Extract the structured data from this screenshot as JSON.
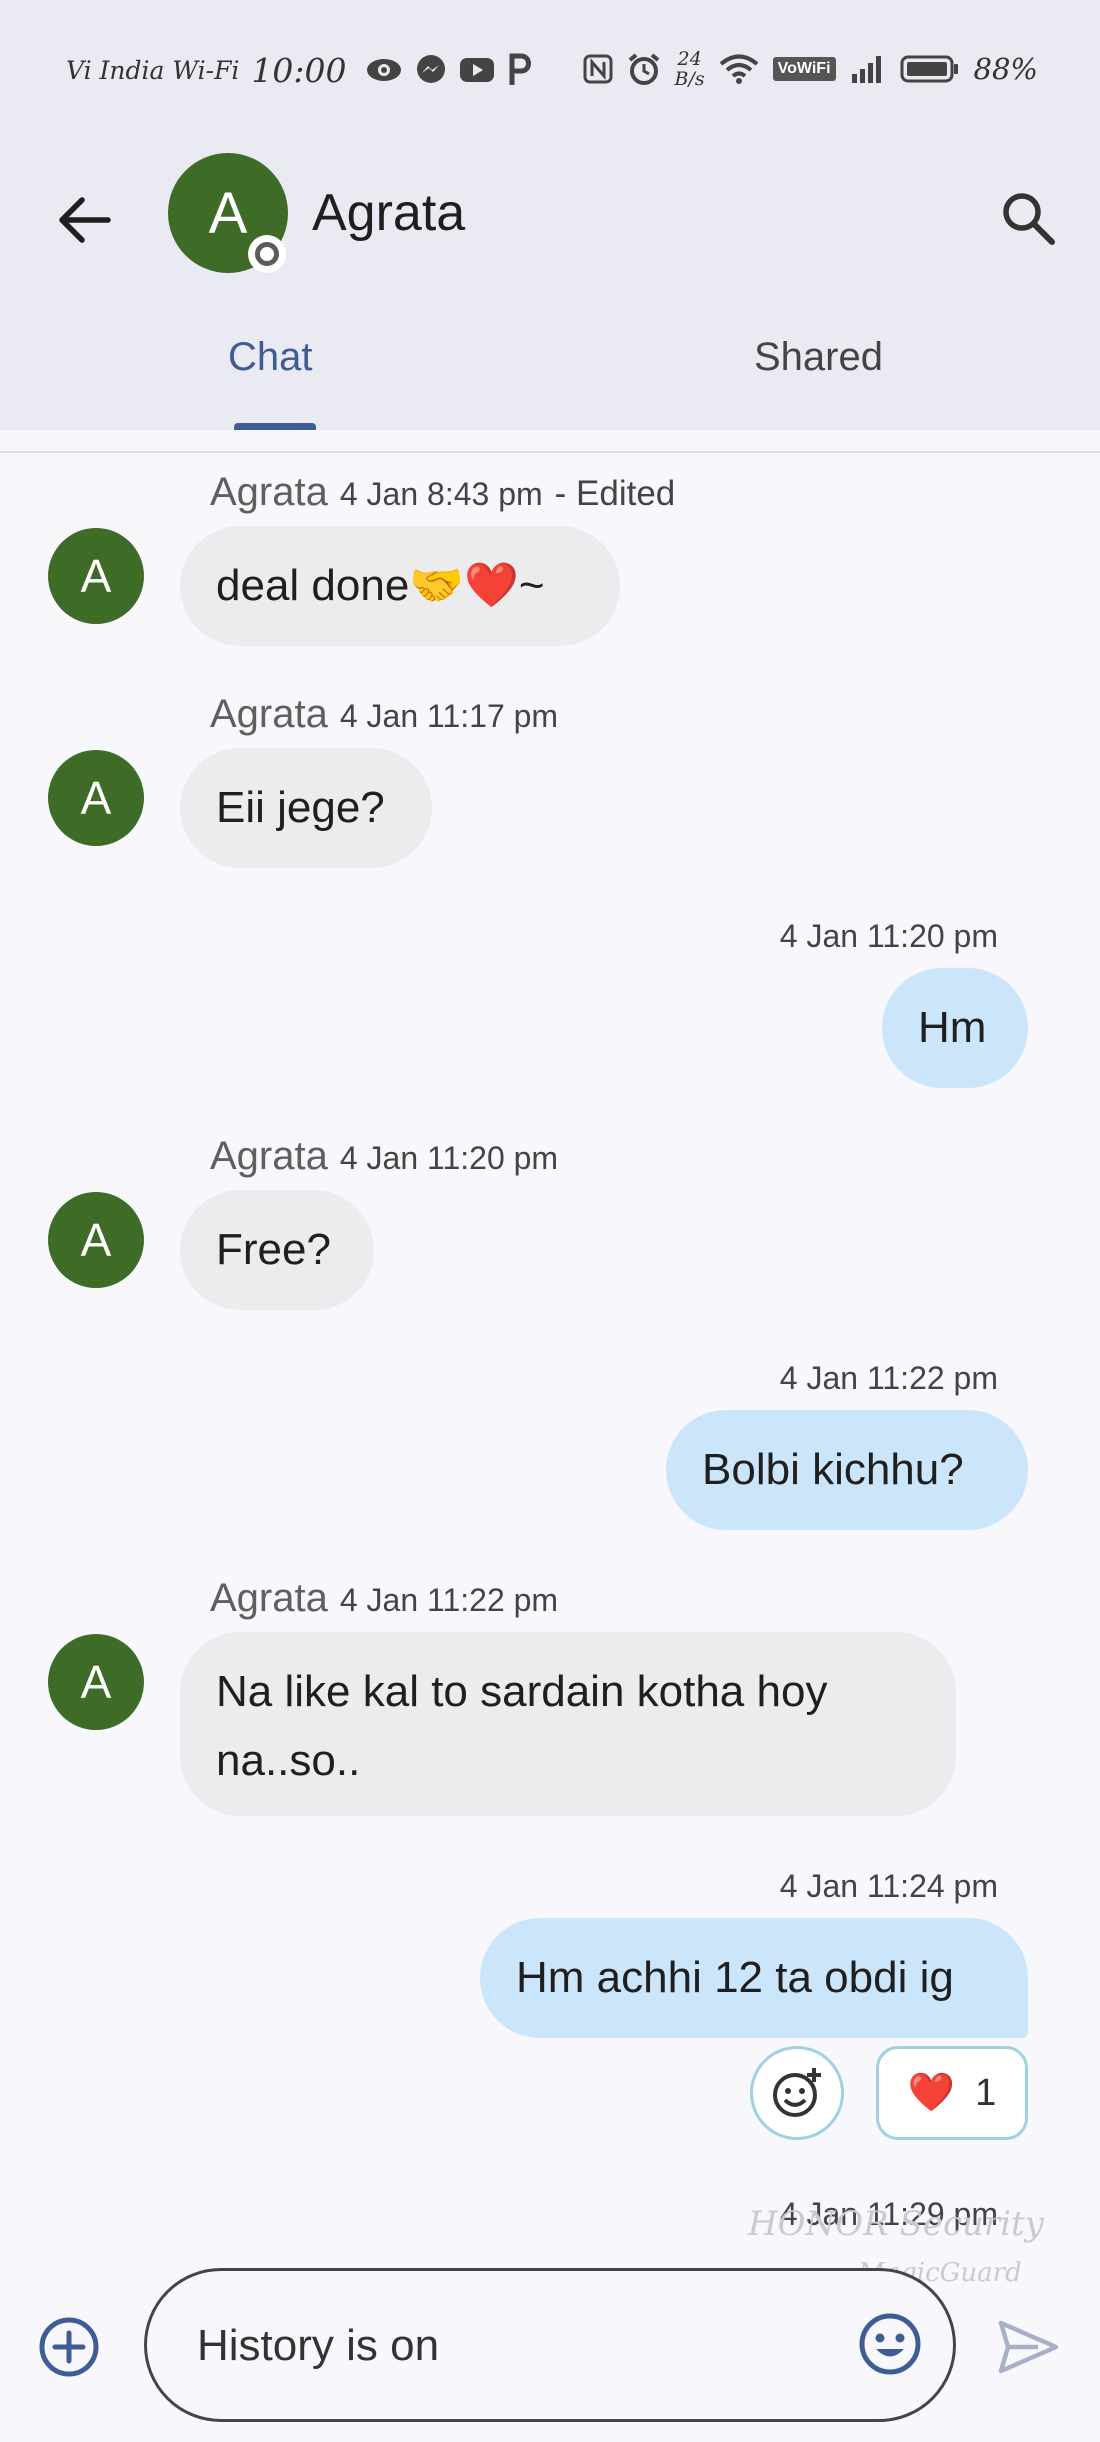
{
  "status_bar": {
    "carrier": "Vi India Wi-Fi",
    "time": "10:00",
    "speed_value": "24",
    "speed_unit": "B/s",
    "vowifi": "VoWiFi",
    "battery": "88%"
  },
  "header": {
    "avatar_letter": "A",
    "contact_name": "Agrata"
  },
  "tabs": [
    {
      "label": "Chat",
      "active": true
    },
    {
      "label": "Shared",
      "active": false
    }
  ],
  "messages": [
    {
      "direction": "incoming",
      "sender": "Agrata",
      "time": "4 Jan 8:43 pm",
      "edited": "- Edited",
      "text": "deal done🤝❤️~",
      "avatar": "A"
    },
    {
      "direction": "incoming",
      "sender": "Agrata",
      "time": "4 Jan 11:17 pm",
      "text": "Eii jege?",
      "avatar": "A"
    },
    {
      "direction": "outgoing",
      "time": "4 Jan 11:20 pm",
      "text": "Hm"
    },
    {
      "direction": "incoming",
      "sender": "Agrata",
      "time": "4 Jan 11:20 pm",
      "text": "Free?",
      "avatar": "A"
    },
    {
      "direction": "outgoing",
      "time": "4 Jan 11:22 pm",
      "text": "Bolbi kichhu?"
    },
    {
      "direction": "incoming",
      "sender": "Agrata",
      "time": "4 Jan 11:22 pm",
      "text": "Na like kal to sardain kotha hoy na..so..",
      "avatar": "A"
    },
    {
      "direction": "outgoing",
      "time": "4 Jan 11:24 pm",
      "text": "Hm achhi 12 ta obdi ig",
      "reaction": {
        "emoji": "❤️",
        "count": "1"
      }
    },
    {
      "direction": "outgoing",
      "time": "4 Jan 11:29 pm"
    }
  ],
  "watermark": {
    "line1": "HONOR Security",
    "line2": "MagicGuard"
  },
  "compose": {
    "placeholder": "History is on"
  },
  "colors": {
    "header_bg": "#e9eaf2",
    "avatar_green": "#3e6b26",
    "active_tab": "#3f5d94",
    "incoming_bubble": "#ececee",
    "outgoing_bubble": "#cbe6fa",
    "reaction_border": "#9fd2df",
    "page_bg": "#f8f8fc"
  },
  "icons": [
    "back-arrow-icon",
    "search-icon",
    "add-reaction-icon",
    "add-circle-icon",
    "emoji-icon",
    "send-icon",
    "eye-icon",
    "messenger-icon",
    "youtube-icon",
    "p-icon",
    "nfc-icon",
    "alarm-icon",
    "wifi-icon",
    "signal-icon",
    "battery-icon"
  ]
}
